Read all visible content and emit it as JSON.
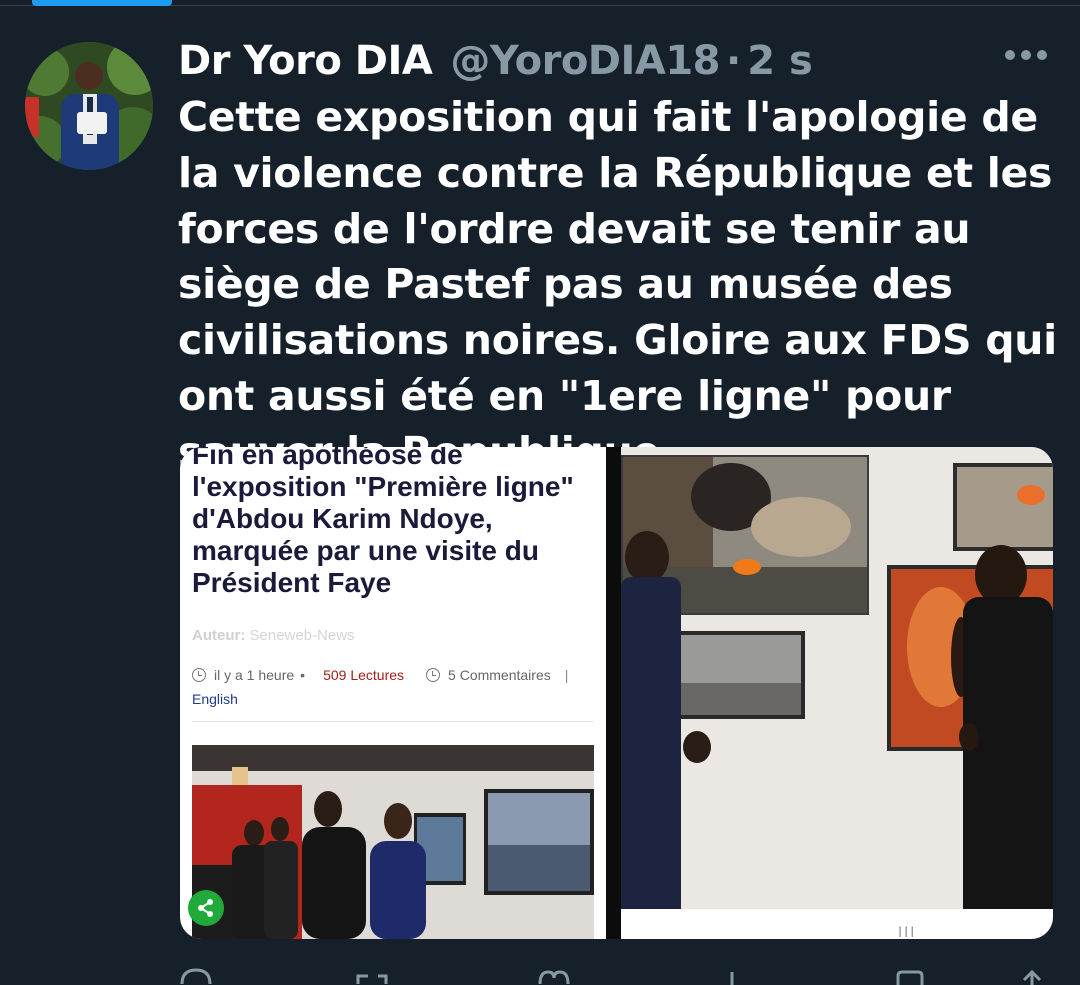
{
  "tweet": {
    "author_name": "Dr Yoro DIA",
    "handle": "@YoroDIA18",
    "separator": "·",
    "time": "2 s",
    "text": "Cette exposition qui fait l'apologie de la violence contre la République et les forces de l'ordre devait se tenir au siège de Pastef pas au musée des civilisations noires. Gloire aux FDS qui ont aussi été en \"1ere ligne\" pour sauver la Republique."
  },
  "article": {
    "title": "Fin en apothéose de l'exposition \"Première ligne\" d'Abdou Karim Ndoye, marquée par une visite du Président Faye",
    "author_label": "Auteur:",
    "author_value": "Seneweb-News",
    "time_ago": "il y a 1 heure",
    "bullet": "•",
    "lectures": "509 Lectures",
    "comments": "5 Commentaires",
    "pipe": "|",
    "language_link": "English"
  },
  "overlay": {
    "nav_hint": "III"
  },
  "colors": {
    "background": "#15202b",
    "accent": "#1d9bf0",
    "muted": "#8899a6",
    "article_title": "#1a1a3a",
    "lectures": "#a0201a",
    "share": "#1faa3a"
  },
  "icons": {
    "more": "more-dots-icon",
    "reply": "reply-icon",
    "retweet": "retweet-icon",
    "like": "heart-icon",
    "views": "views-icon",
    "bookmark": "bookmark-icon",
    "share": "share-icon"
  }
}
